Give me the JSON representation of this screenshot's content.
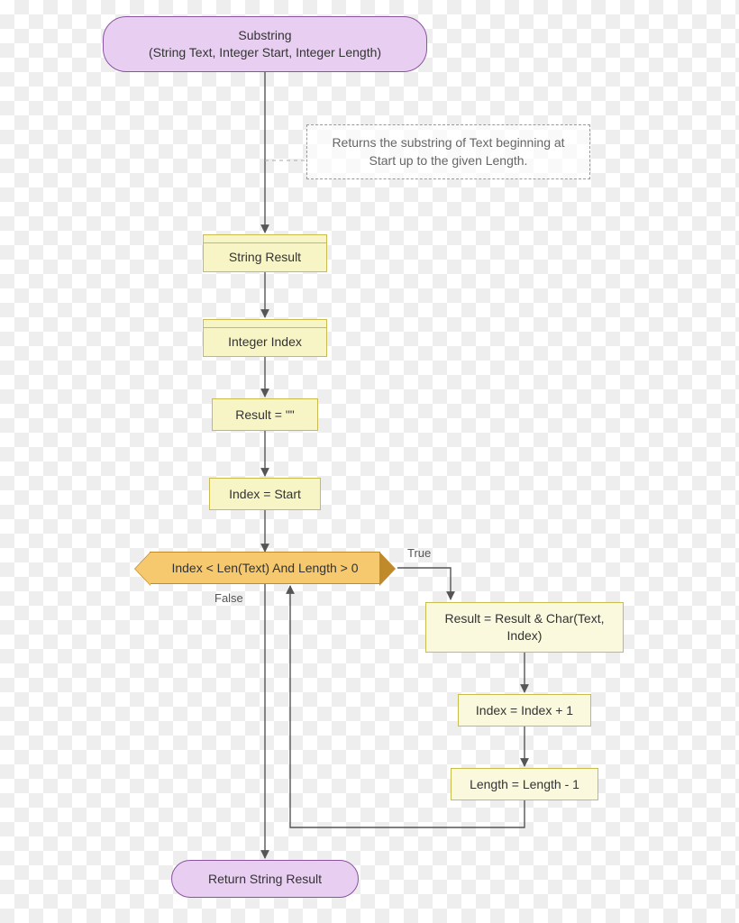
{
  "terminator_start": {
    "title": "Substring",
    "signature": "(String Text, Integer Start, Integer Length)"
  },
  "comment": "Returns the substring of Text beginning at Start up to the given Length.",
  "declare1": "String Result",
  "declare2": "Integer Index",
  "assign1": "Result = \"\"",
  "assign2": "Index = Start",
  "decision": "Index < Len(Text) And Length > 0",
  "labels": {
    "true": "True",
    "false": "False"
  },
  "body1": "Result = Result & Char(Text, Index)",
  "body2": "Index = Index + 1",
  "body3": "Length = Length - 1",
  "terminator_end": "Return String Result"
}
